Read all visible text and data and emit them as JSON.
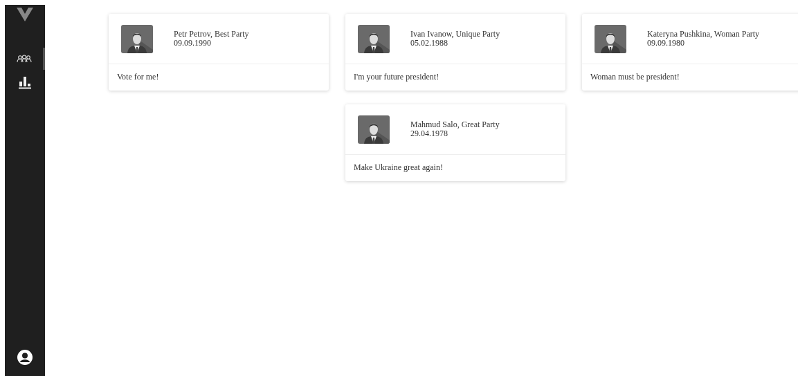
{
  "sidebar": {
    "items": [
      {
        "kind": "people",
        "selected": true
      },
      {
        "kind": "chart",
        "selected": false
      }
    ]
  },
  "candidates": [
    {
      "name": "Petr Petrov, Best Party",
      "birth_date": "09.09.1990",
      "slogan": "Vote for me!"
    },
    {
      "name": "Ivan Ivanow, Unique Party",
      "birth_date": "05.02.1988",
      "slogan": "I'm your future president!"
    },
    {
      "name": "Kateryna Pushkina, Woman Party",
      "birth_date": "09.09.1980",
      "slogan": "Woman must be president!"
    },
    {
      "name": "Mahmud Salo, Great Party",
      "birth_date": "29.04.1978",
      "slogan": "Make Ukraine great again!"
    }
  ]
}
